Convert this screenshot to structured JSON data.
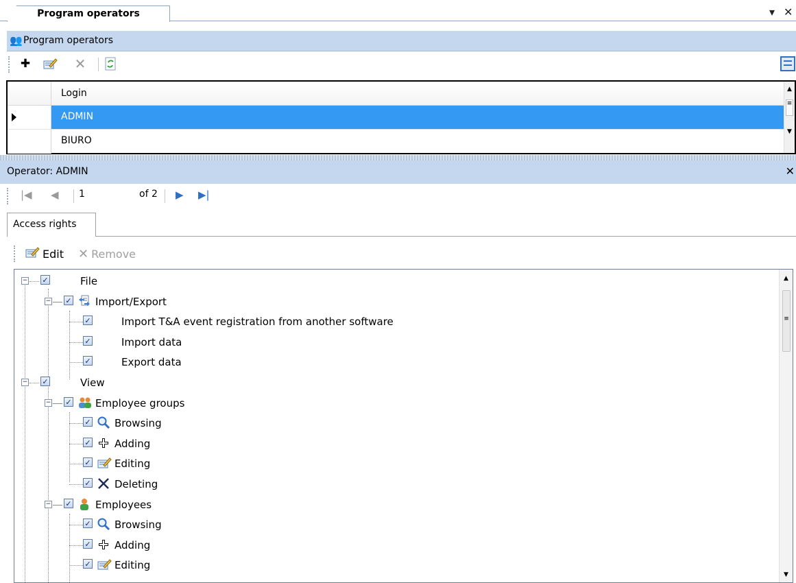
{
  "document_tab": {
    "title": "Program operators"
  },
  "panel": {
    "title": "Program operators"
  },
  "grid": {
    "column_header": "Login",
    "rows": [
      {
        "login": "ADMIN",
        "selected": true
      },
      {
        "login": "BIURO",
        "selected": false
      }
    ]
  },
  "details": {
    "title": "Operator: ADMIN",
    "navigator": {
      "position": "1",
      "of_text": "of 2"
    },
    "tab": "Access rights",
    "toolbar": {
      "edit_label": "Edit",
      "remove_label": "Remove"
    }
  },
  "tree": {
    "nodes": [
      {
        "label": "File",
        "level": 0,
        "expander": "minus",
        "icon": ""
      },
      {
        "label": "Import/Export",
        "level": 1,
        "expander": "minus",
        "icon": "import-export-icon"
      },
      {
        "label": "Import T&A event registration from another software",
        "level": 2,
        "expander": "",
        "icon": ""
      },
      {
        "label": "Import data",
        "level": 2,
        "expander": "",
        "icon": ""
      },
      {
        "label": "Export data",
        "level": 2,
        "expander": "",
        "icon": ""
      },
      {
        "label": "View",
        "level": 0,
        "expander": "minus",
        "icon": ""
      },
      {
        "label": "Employee groups",
        "level": 1,
        "expander": "minus",
        "icon": "employee-groups-icon"
      },
      {
        "label": "Browsing",
        "level": 2,
        "expander": "",
        "icon": "magnifier-icon"
      },
      {
        "label": "Adding",
        "level": 2,
        "expander": "",
        "icon": "plus-icon"
      },
      {
        "label": "Editing",
        "level": 2,
        "expander": "",
        "icon": "edit-icon"
      },
      {
        "label": "Deleting",
        "level": 2,
        "expander": "",
        "icon": "delete-icon"
      },
      {
        "label": "Employees",
        "level": 1,
        "expander": "minus",
        "icon": "employee-icon"
      },
      {
        "label": "Browsing",
        "level": 2,
        "expander": "",
        "icon": "magnifier-icon"
      },
      {
        "label": "Adding",
        "level": 2,
        "expander": "",
        "icon": "plus-icon"
      },
      {
        "label": "Editing",
        "level": 2,
        "expander": "",
        "icon": "edit-icon"
      }
    ]
  },
  "colors": {
    "selection": "#3399f3",
    "band": "#c4d7ee",
    "border": "#8ea3c0"
  }
}
